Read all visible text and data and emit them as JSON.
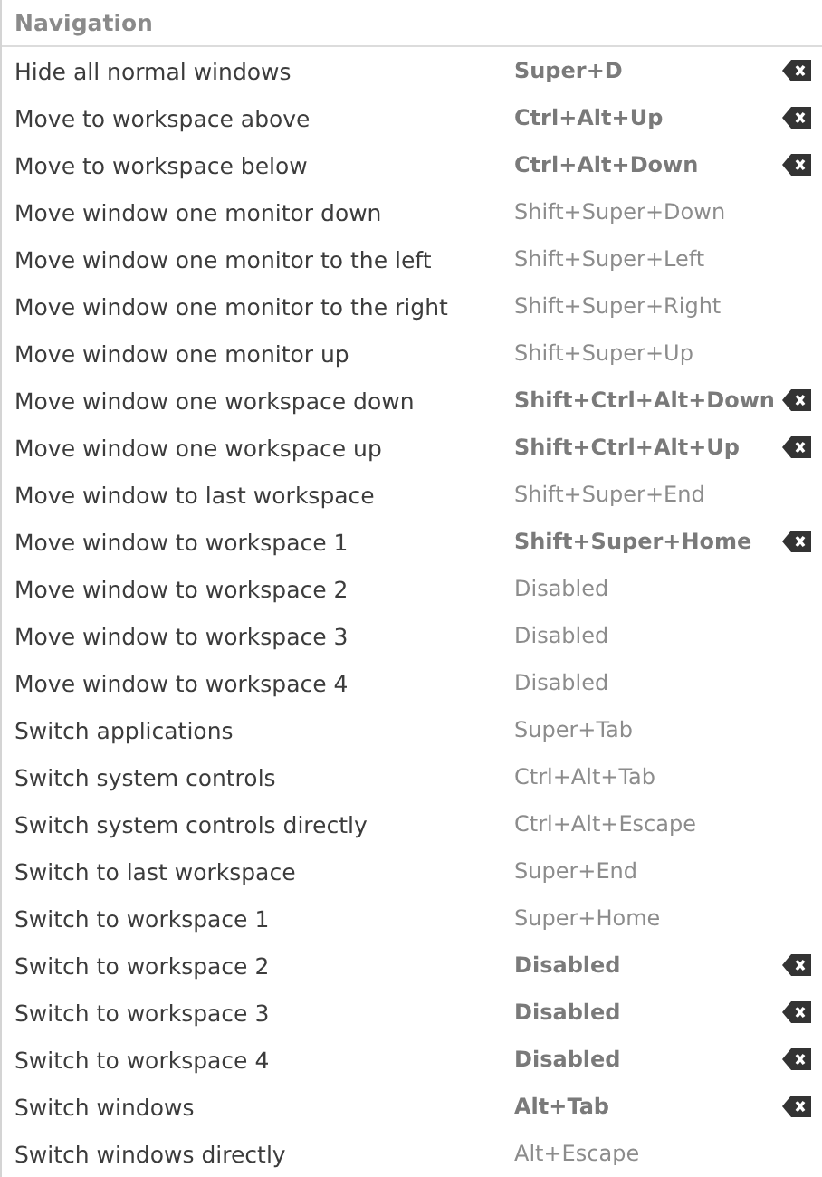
{
  "section": {
    "title": "Navigation"
  },
  "rows": [
    {
      "action": "Hide all normal windows",
      "shortcut": "Super+D",
      "customized": true
    },
    {
      "action": "Move to workspace above",
      "shortcut": "Ctrl+Alt+Up",
      "customized": true
    },
    {
      "action": "Move to workspace below",
      "shortcut": "Ctrl+Alt+Down",
      "customized": true
    },
    {
      "action": "Move window one monitor down",
      "shortcut": "Shift+Super+Down",
      "customized": false
    },
    {
      "action": "Move window one monitor to the left",
      "shortcut": "Shift+Super+Left",
      "customized": false
    },
    {
      "action": "Move window one monitor to the right",
      "shortcut": "Shift+Super+Right",
      "customized": false
    },
    {
      "action": "Move window one monitor up",
      "shortcut": "Shift+Super+Up",
      "customized": false
    },
    {
      "action": "Move window one workspace down",
      "shortcut": "Shift+Ctrl+Alt+Down",
      "customized": true
    },
    {
      "action": "Move window one workspace up",
      "shortcut": "Shift+Ctrl+Alt+Up",
      "customized": true
    },
    {
      "action": "Move window to last workspace",
      "shortcut": "Shift+Super+End",
      "customized": false
    },
    {
      "action": "Move window to workspace 1",
      "shortcut": "Shift+Super+Home",
      "customized": true
    },
    {
      "action": "Move window to workspace 2",
      "shortcut": "Disabled",
      "customized": false
    },
    {
      "action": "Move window to workspace 3",
      "shortcut": "Disabled",
      "customized": false
    },
    {
      "action": "Move window to workspace 4",
      "shortcut": "Disabled",
      "customized": false
    },
    {
      "action": "Switch applications",
      "shortcut": "Super+Tab",
      "customized": false
    },
    {
      "action": "Switch system controls",
      "shortcut": "Ctrl+Alt+Tab",
      "customized": false
    },
    {
      "action": "Switch system controls directly",
      "shortcut": "Ctrl+Alt+Escape",
      "customized": false
    },
    {
      "action": "Switch to last workspace",
      "shortcut": "Super+End",
      "customized": false
    },
    {
      "action": "Switch to workspace 1",
      "shortcut": "Super+Home",
      "customized": false
    },
    {
      "action": "Switch to workspace 2",
      "shortcut": "Disabled",
      "customized": true
    },
    {
      "action": "Switch to workspace 3",
      "shortcut": "Disabled",
      "customized": true
    },
    {
      "action": "Switch to workspace 4",
      "shortcut": "Disabled",
      "customized": true
    },
    {
      "action": "Switch windows",
      "shortcut": "Alt+Tab",
      "customized": true
    },
    {
      "action": "Switch windows directly",
      "shortcut": "Alt+Escape",
      "customized": false
    }
  ]
}
